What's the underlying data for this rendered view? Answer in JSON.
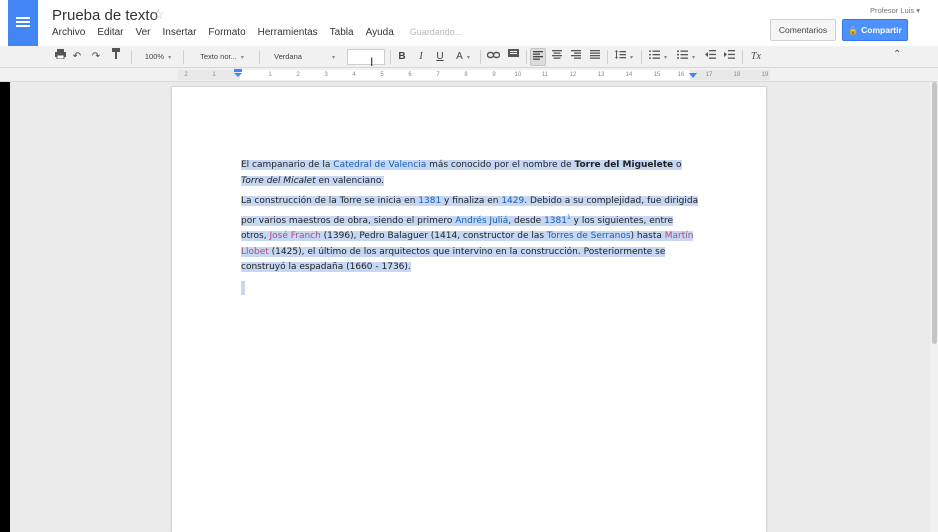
{
  "header": {
    "title": "Prueba de texto",
    "user": "Profesor Luis",
    "comments_label": "Comentarios",
    "share_label": "Compartir"
  },
  "menu": {
    "items": [
      "Archivo",
      "Editar",
      "Ver",
      "Insertar",
      "Formato",
      "Herramientas",
      "Tabla",
      "Ayuda"
    ],
    "status": "Guardando..."
  },
  "toolbar": {
    "zoom": "100%",
    "style": "Texto nor...",
    "font": "Verdana",
    "bold": "B",
    "italic": "I",
    "underline": "U",
    "text_color": "A",
    "clear_format": "Tx"
  },
  "ruler": {
    "numbers": [
      "2",
      "1",
      "",
      "1",
      "2",
      "3",
      "4",
      "5",
      "6",
      "7",
      "8",
      "9",
      "10",
      "11",
      "12",
      "13",
      "14",
      "15",
      "16",
      "17",
      "18",
      "19"
    ]
  },
  "document": {
    "p1": {
      "a": "El campanario de la ",
      "link": "Catedral de Valencia",
      "b": " más conocido por el nombre de ",
      "bold": "Torre del Miguelete",
      "c": " o ",
      "italic": "Torre del Micalet",
      "d": " en valenciano."
    },
    "p2": {
      "a": "La construcción de la Torre se inicia en ",
      "y1": "1381",
      "b": " y finaliza en ",
      "y2": "1429",
      "c": ". Debido a su complejidad, fue dirigida por varios maestros de obra, siendo el primero ",
      "andres": "Andrés Juliá",
      "d": ", desde ",
      "y3": "1381",
      "sup": "1",
      "e": " y los siguientes, entre otros, ",
      "jose": "José Franch",
      "f": " (1396), Pedro Balaguer (1414, constructor de las ",
      "torres": "Torres de Serranos",
      "g": ") hasta ",
      "martin": "Martín Llobet",
      "h": " (1425), el último de los arquitectos que intervino en la construcción. Posteriormente se construyó la espadaña (1660 - 1736)."
    }
  },
  "colors": {
    "accent": "#4285f4",
    "share": "#4d90fe",
    "selection": "#c5d7f2",
    "link": "#1a5fb4",
    "visited_link": "#b05078"
  }
}
